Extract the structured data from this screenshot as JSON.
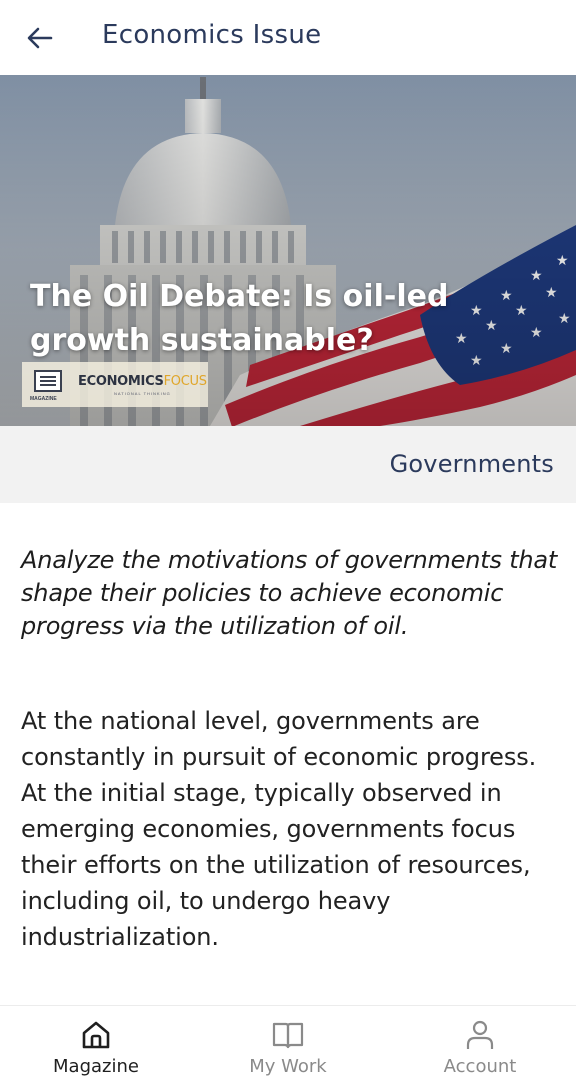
{
  "header": {
    "title": "Economics Issue",
    "back_icon": "arrow-left-icon"
  },
  "hero": {
    "title": "The Oil Debate: Is oil-led growth sustainable?",
    "logo": {
      "name_part1": "ECONOMICS",
      "name_part2": "FOCUS",
      "tagline": "NATIONAL THINKING",
      "mark_text": "MAGAZINE"
    }
  },
  "category": {
    "label": "Governments"
  },
  "article": {
    "summary": "Analyze the motivations of governments that shape their policies to achieve economic progress via the utilization of oil.",
    "body": "At the national level, governments are constantly in pursuit of economic progress. At the initial stage, typically observed in emerging economies, governments focus their efforts on the utilization of resources, including oil, to undergo heavy industrialization."
  },
  "bottom_nav": {
    "items": [
      {
        "label": "Magazine",
        "icon": "home-icon",
        "active": true
      },
      {
        "label": "My Work",
        "icon": "book-icon",
        "active": false
      },
      {
        "label": "Account",
        "icon": "person-icon",
        "active": false
      }
    ]
  },
  "colors": {
    "title_text": "#2b3a5c",
    "category_bg": "#f2f2f2",
    "nav_active": "#1f1f1f",
    "nav_inactive": "#8a8a8a",
    "brand_accent": "#e0a62a"
  }
}
